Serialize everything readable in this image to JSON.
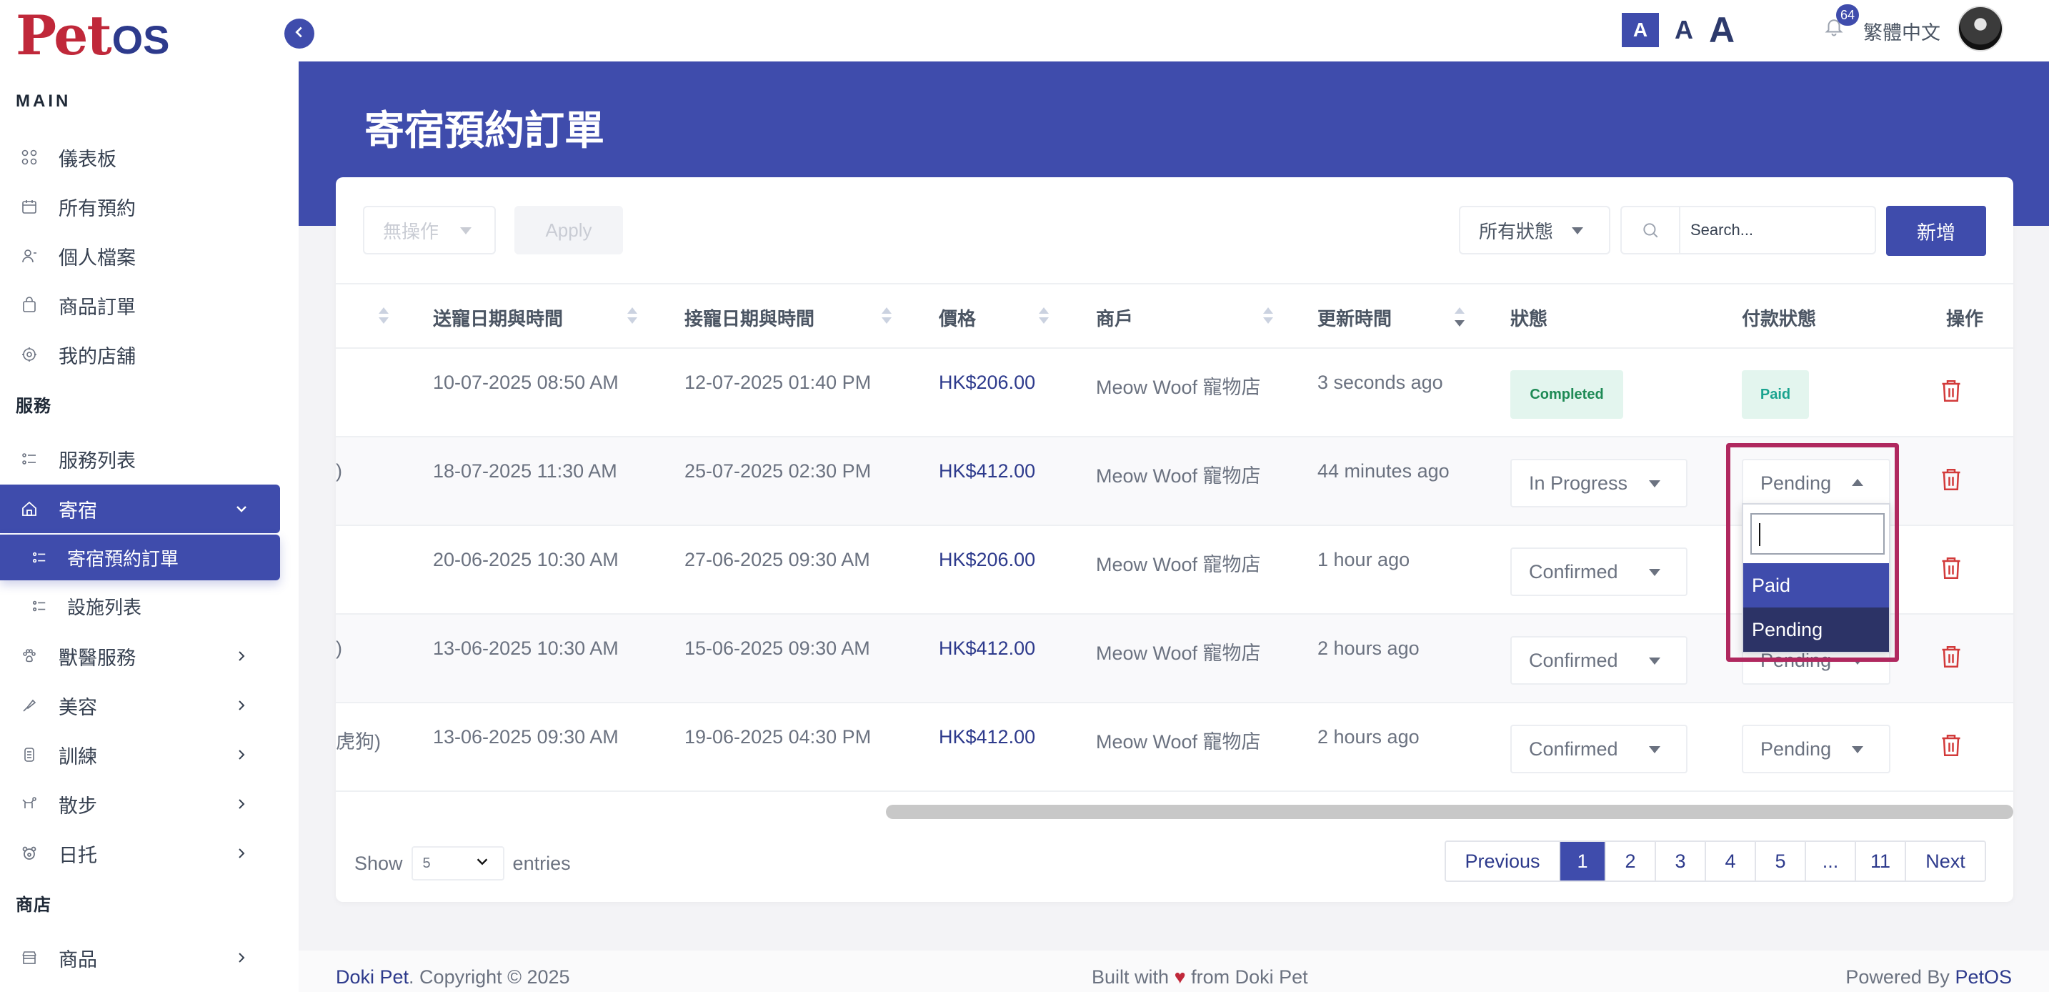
{
  "logo": {
    "part1": "Pet",
    "part2": "OS"
  },
  "sidebar": {
    "section_main": "MAIN",
    "main_items": [
      {
        "label": "儀表板",
        "icon": "dashboard-icon"
      },
      {
        "label": "所有預約",
        "icon": "calendar-icon"
      },
      {
        "label": "個人檔案",
        "icon": "user-icon"
      },
      {
        "label": "商品訂單",
        "icon": "shopping-bag-icon"
      },
      {
        "label": "我的店舖",
        "icon": "store-icon"
      }
    ],
    "section_services": "服務",
    "service_list": "服務列表",
    "boarding": "寄宿",
    "boarding_sub": [
      "寄宿預約訂單",
      "設施列表"
    ],
    "more_items": [
      {
        "label": "獸醫服務",
        "icon": "paw-icon"
      },
      {
        "label": "美容",
        "icon": "brush-icon"
      },
      {
        "label": "訓練",
        "icon": "training-icon"
      },
      {
        "label": "散步",
        "icon": "dog-walk-icon"
      },
      {
        "label": "日托",
        "icon": "daycare-icon"
      }
    ],
    "section_shop": "商店",
    "shop_items": [
      {
        "label": "商品",
        "icon": "shop-icon"
      }
    ]
  },
  "header": {
    "font_small": "A",
    "font_medium": "A",
    "font_large": "A",
    "notif_count": "64",
    "language": "繁體中文"
  },
  "page": {
    "title": "寄宿預約訂單"
  },
  "toolbar": {
    "bulk_action": "無操作",
    "apply": "Apply",
    "status_filter": "所有狀態",
    "search_placeholder": "Search...",
    "new_button": "新增"
  },
  "table": {
    "headers": [
      "送寵日期與時間",
      "接寵日期與時間",
      "價格",
      "商戶",
      "更新時間",
      "狀態",
      "付款狀態",
      "操作"
    ],
    "rows": [
      {
        "lead": "",
        "dropoff": "10-07-2025 08:50 AM",
        "pickup": "12-07-2025 01:40 PM",
        "price": "HK$206.00",
        "merchant": "Meow Woof 寵物店",
        "updated": "3 seconds ago",
        "status": "Completed",
        "payment": "Paid"
      },
      {
        "lead": ")",
        "dropoff": "18-07-2025 11:30 AM",
        "pickup": "25-07-2025 02:30 PM",
        "price": "HK$412.00",
        "merchant": "Meow Woof 寵物店",
        "updated": "44 minutes ago",
        "status": "In Progress",
        "payment": "Pending"
      },
      {
        "lead": "",
        "dropoff": "20-06-2025 10:30 AM",
        "pickup": "27-06-2025 09:30 AM",
        "price": "HK$206.00",
        "merchant": "Meow Woof 寵物店",
        "updated": "1 hour ago",
        "status": "Confirmed",
        "payment": ""
      },
      {
        "lead": ")",
        "dropoff": "13-06-2025 10:30 AM",
        "pickup": "15-06-2025 09:30 AM",
        "price": "HK$412.00",
        "merchant": "Meow Woof 寵物店",
        "updated": "2 hours ago",
        "status": "Confirmed",
        "payment": "Pending"
      },
      {
        "lead": "虎狗)",
        "dropoff": "13-06-2025 09:30 AM",
        "pickup": "19-06-2025 04:30 PM",
        "price": "HK$412.00",
        "merchant": "Meow Woof 寵物店",
        "updated": "2 hours ago",
        "status": "Confirmed",
        "payment": "Pending"
      }
    ]
  },
  "dropdown": {
    "options": [
      "Paid",
      "Pending"
    ]
  },
  "footer_table": {
    "show": "Show",
    "entries_value": "5",
    "entries": "entries",
    "pages": [
      "Previous",
      "1",
      "2",
      "3",
      "4",
      "5",
      "...",
      "11",
      "Next"
    ]
  },
  "footer": {
    "brand": "Doki Pet",
    "copyright": ". Copyright © 2025",
    "built_prefix": "Built with",
    "heart": "♥",
    "built_suffix": "from Doki Pet",
    "powered_prefix": "Powered By",
    "powered_brand": "PetOS"
  },
  "colors": {
    "primary": "#3f4cac",
    "brand_red": "#c0283a",
    "highlight": "#b0285f",
    "danger": "#d23a3a"
  }
}
